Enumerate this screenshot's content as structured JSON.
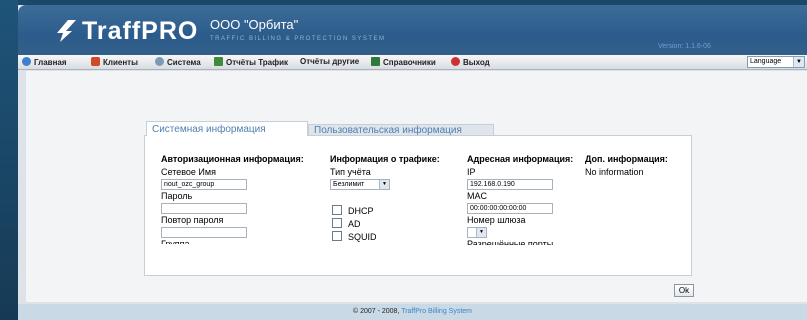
{
  "app": {
    "logo_text": "TraffPRO",
    "company": "ООО \"Орбита\"",
    "tagline": "TRAFFIC BILLING & PROTECTION SYSTEM",
    "version": "Version: 1.1.6-06"
  },
  "menu": {
    "items": [
      {
        "label": "Главная",
        "icon": "globe-icon",
        "color": "#3a7fd0"
      },
      {
        "label": "Клиенты",
        "icon": "users-icon",
        "color": "#d04a2a"
      },
      {
        "label": "Система",
        "icon": "gears-icon",
        "color": "#7a9ab8"
      },
      {
        "label": "Отчёты Трафик",
        "icon": "bar-chart-icon",
        "color": "#3f8a3f"
      },
      {
        "label": "Отчёты другие",
        "icon": "",
        "color": ""
      },
      {
        "label": "Справочники",
        "icon": "book-icon",
        "color": "#2e7a3a"
      },
      {
        "label": "Выход",
        "icon": "exit-icon",
        "color": "#d03030"
      }
    ],
    "language": "Language"
  },
  "tabs": {
    "active": "Системная информация",
    "inactive": "Пользовательская информация"
  },
  "auth": {
    "heading": "Авторизационная информация:",
    "network_name_label": "Сетевое Имя",
    "network_name_value": "nout_ozc_group",
    "password_label": "Пароль",
    "password_value": "",
    "repeat_password_label": "Повтор пароля",
    "repeat_password_value": "",
    "group_label": "Группа"
  },
  "traffic": {
    "heading": "Информация о трафике:",
    "account_type_label": "Тип учёта",
    "account_type_value": "Безлимит",
    "checkboxes": [
      {
        "label": "DHCP",
        "checked": false
      },
      {
        "label": "AD",
        "checked": false
      },
      {
        "label": "SQUID",
        "checked": false
      }
    ]
  },
  "address": {
    "heading": "Адресная информация:",
    "ip_label": "IP",
    "ip_value": "192.168.0.190",
    "mac_label": "MAC",
    "mac_value": "00:00:00:00:00:00",
    "gateway_label": "Номер шлюза",
    "gateway_value": "",
    "ports_label": "Разрешённые порты"
  },
  "extra": {
    "heading": "Доп. информация:",
    "value": "No information"
  },
  "buttons": {
    "ok": "Ok"
  },
  "footer": {
    "copyright": "© 2007 - 2008, ",
    "brand": "TraffPro Billing System"
  }
}
